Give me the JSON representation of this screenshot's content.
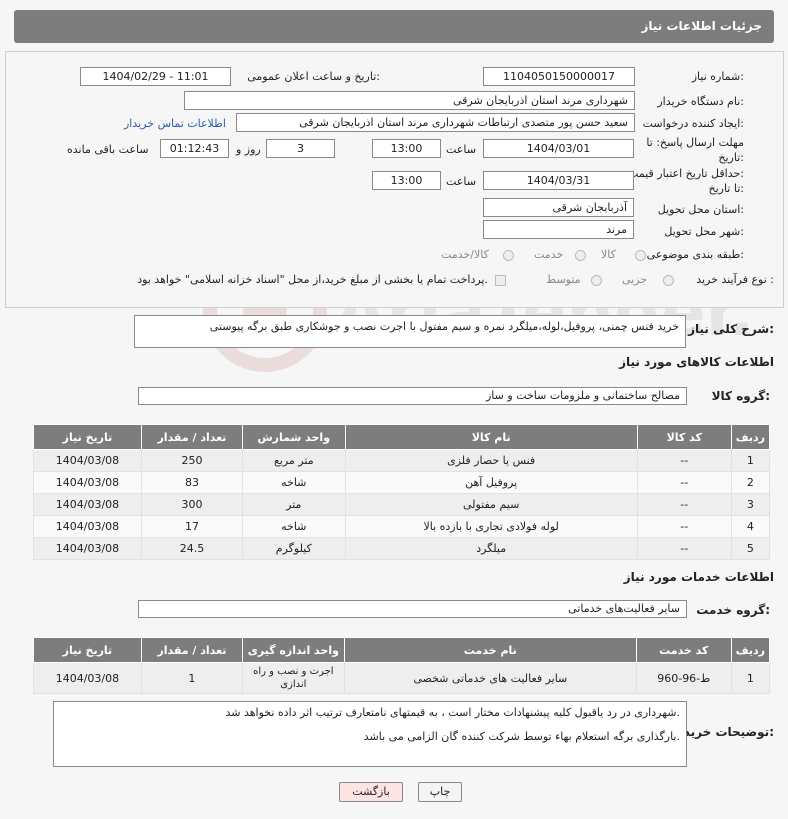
{
  "header": {
    "title": "جزئیات اطلاعات نیاز"
  },
  "form": {
    "need_number_label": "شماره نیاز:",
    "need_number": "1104050150000017",
    "announce_label": "تاریخ و ساعت اعلان عمومی:",
    "announce_value": "1404/02/29 - 11:01",
    "buyer_org_label": "نام دستگاه خریدار:",
    "buyer_org": "شهرداری مرند استان اذربایجان شرقی",
    "creator_label": "ایجاد کننده درخواست:",
    "creator": "سعید حسن پور متصدی ارتباطات شهرداری مرند استان اذربایجان شرقی",
    "contact_link": "اطلاعات تماس خریدار",
    "deadline_label_1": "مهلت ارسال پاسخ: تا",
    "deadline_label_2": "تاریخ:",
    "deadline_date": "1404/03/01",
    "time_label": "ساعت",
    "deadline_time": "13:00",
    "days_value": "3",
    "days_label": "روز و",
    "remaining_time": "01:12:43",
    "remaining_label": "ساعت باقی مانده",
    "min_price_label_1": "حداقل تاریخ اعتبار قیمت:",
    "min_price_label_2": "تا تاریخ:",
    "min_price_date": "1404/03/31",
    "min_price_time": "13:00",
    "province_label": "استان محل تحویل:",
    "province": "آذربایجان شرقی",
    "city_label": "شهر محل تحویل:",
    "city": "مرند",
    "category_label": "طبقه بندی موضوعی:",
    "category_options": [
      "کالا",
      "خدمت",
      "کالا/خدمت"
    ],
    "process_label": "نوع فرآیند خرید :",
    "process_options": [
      "جزیی",
      "متوسط"
    ],
    "payment_note": "پرداخت تمام یا بخشی از مبلغ خرید،از محل \"اسناد خزانه اسلامی\" خواهد بود."
  },
  "description": {
    "label": "شرح کلی نیاز:",
    "text": "خرید فنس چمنی، پروفیل،لوله،میلگرد نمره و سیم مفتول با اجرت نصب و جوشکاری طبق برگه پیوستی"
  },
  "goods": {
    "section_title": "اطلاعات کالاهای مورد نیاز",
    "group_label": "گروه کالا:",
    "group_value": "مصالح ساختمانی و ملزومات ساخت و ساز",
    "columns": [
      "ردیف",
      "کد کالا",
      "نام کالا",
      "واحد شمارش",
      "تعداد / مقدار",
      "تاریخ نیاز"
    ],
    "rows": [
      {
        "row": "1",
        "code": "--",
        "name": "فنس یا حصار فلزی",
        "unit": "متر مربع",
        "qty": "250",
        "date": "1404/03/08"
      },
      {
        "row": "2",
        "code": "--",
        "name": "پروفیل آهن",
        "unit": "شاخه",
        "qty": "83",
        "date": "1404/03/08"
      },
      {
        "row": "3",
        "code": "--",
        "name": "سیم مفتولی",
        "unit": "متر",
        "qty": "300",
        "date": "1404/03/08"
      },
      {
        "row": "4",
        "code": "--",
        "name": "لوله فولادی تجاری با بازده بالا",
        "unit": "شاخه",
        "qty": "17",
        "date": "1404/03/08"
      },
      {
        "row": "5",
        "code": "--",
        "name": "میلگرد",
        "unit": "کیلوگرم",
        "qty": "24.5",
        "date": "1404/03/08"
      }
    ]
  },
  "services": {
    "section_title": "اطلاعات خدمات مورد نیاز",
    "group_label": "گروه خدمت:",
    "group_value": "سایر فعالیت‌های خدماتی",
    "columns": [
      "ردیف",
      "کد خدمت",
      "نام خدمت",
      "واحد اندازه گیری",
      "تعداد / مقدار",
      "تاریخ نیاز"
    ],
    "rows": [
      {
        "row": "1",
        "code": "ط-96-960",
        "name": "سایر فعالیت های خدماتی شخصی",
        "unit_1": "اجرت و نصب و راه",
        "unit_2": "اندازی",
        "qty": "1",
        "date": "1404/03/08"
      }
    ]
  },
  "notes": {
    "label": "توضیحات خریدار:",
    "line1": "شهرداری در رد یاقبول کلیه پیشنهادات مختار است ، به قیمتهای نامتعارف ترتیب اثر داده نخواهد شد.",
    "line2": "بارگذاری برگه استعلام بهاء توسط شرکت کننده گان الزامی می باشد."
  },
  "buttons": {
    "print": "چاپ",
    "back": "بازگشت"
  },
  "watermark": {
    "text": "AriaTender.net"
  },
  "colors": {
    "header_bg": "#7d7d7d",
    "link": "#2a5db0",
    "back_btn_bg": "#fde3e3"
  }
}
